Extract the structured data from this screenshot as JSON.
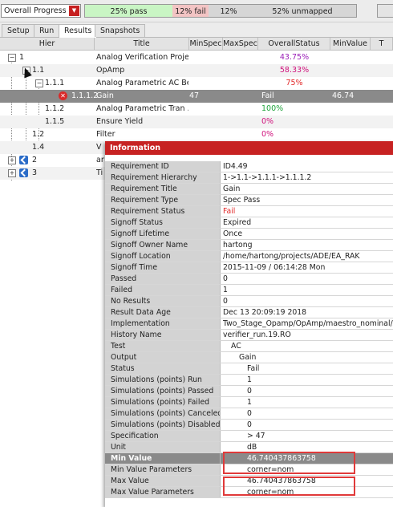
{
  "progress": {
    "selector": "Overall Progress",
    "pass": "25% pass",
    "fail": "12% fail",
    "pct": "12%",
    "unmapped": "52% unmapped"
  },
  "tabs": [
    "Setup",
    "Run",
    "Results",
    "Snapshots"
  ],
  "grid": {
    "columns": [
      "Hier",
      "Title",
      "MinSpec",
      "MaxSpec",
      "OverallStatus",
      "MinValue",
      "T"
    ],
    "rows": [
      {
        "hier": "1",
        "title": "Analog Verification Proje...",
        "min": "",
        "status": "43.75%",
        "minv": ""
      },
      {
        "hier": "1.1",
        "title": "OpAmp",
        "min": "",
        "status": "58.33%",
        "minv": ""
      },
      {
        "hier": "1.1.1",
        "title": "Analog Parametric AC Be...",
        "min": "",
        "status": "75%",
        "minv": ""
      },
      {
        "hier": "1.1.1.2",
        "title": "Gain",
        "min": "47",
        "status": "Fail",
        "minv": "46.74"
      },
      {
        "hier": "1.1.2",
        "title": "Analog Parametric Tran ...",
        "min": "",
        "status": "100%",
        "minv": ""
      },
      {
        "hier": "1.1.5",
        "title": "Ensure Yield",
        "min": "",
        "status": "0%",
        "minv": ""
      },
      {
        "hier": "1.2",
        "title": "Filter",
        "min": "",
        "status": "0%",
        "minv": ""
      },
      {
        "hier": "1.4",
        "title": "V",
        "min": "",
        "status": "",
        "minv": ""
      },
      {
        "hier": "2",
        "title": "ar",
        "min": "",
        "status": "",
        "minv": ""
      },
      {
        "hier": "3",
        "title": "Ti",
        "min": "",
        "status": "",
        "minv": ""
      }
    ]
  },
  "info": {
    "title": "Information",
    "rows": [
      {
        "label": "Requirement ID",
        "value": "ID4.49"
      },
      {
        "label": "Requirement Hierarchy",
        "value": "1->1.1->1.1.1->1.1.1.2"
      },
      {
        "label": "Requirement Title",
        "value": "Gain"
      },
      {
        "label": "Requirement Type",
        "value": "Spec Pass"
      },
      {
        "label": "Requirement Status",
        "value": "Fail"
      },
      {
        "label": "Signoff Status",
        "value": "Expired"
      },
      {
        "label": "Signoff Lifetime",
        "value": "Once"
      },
      {
        "label": "Signoff Owner Name",
        "value": "hartong"
      },
      {
        "label": "Signoff Location",
        "value": "/home/hartong/projects/ADE/EA_RAK"
      },
      {
        "label": "Signoff Time",
        "value": "2015-11-09 / 06:14:28 Mon"
      },
      {
        "label": "Passed",
        "value": "0"
      },
      {
        "label": "Failed",
        "value": "1"
      },
      {
        "label": "No Results",
        "value": "0"
      },
      {
        "label": "Result Data Age",
        "value": "Dec 13 20:09:19 2018"
      },
      {
        "label": "Implementation",
        "value": "Two_Stage_Opamp/OpAmp/maestro_nominal/Act"
      },
      {
        "label": "History Name",
        "value": "verifier_run.19.RO"
      },
      {
        "label": "Test",
        "value": "AC"
      },
      {
        "label": "Output",
        "value": "Gain"
      },
      {
        "label": "Status",
        "value": "Fail"
      },
      {
        "label": "Simulations (points) Run",
        "value": "1"
      },
      {
        "label": "Simulations (points) Passed",
        "value": "0"
      },
      {
        "label": "Simulations (points) Failed",
        "value": "1"
      },
      {
        "label": "Simulations (points) Canceled",
        "value": "0"
      },
      {
        "label": "Simulations (points) Disabled",
        "value": "0"
      },
      {
        "label": "Specification",
        "value": "> 47"
      },
      {
        "label": "Unit",
        "value": "dB"
      },
      {
        "label": "Min Value",
        "value": "46.740437863758"
      },
      {
        "label": "Min Value Parameters",
        "value": "corner=nom"
      },
      {
        "label": "Max Value",
        "value": "46.740437863758"
      },
      {
        "label": "Max Value Parameters",
        "value": "corner=nom"
      }
    ]
  }
}
